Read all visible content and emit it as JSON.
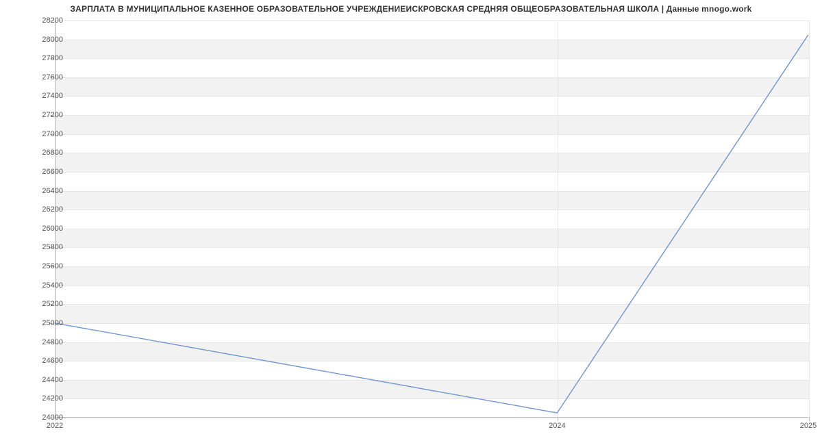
{
  "title": "ЗАРПЛАТА В МУНИЦИПАЛЬНОЕ КАЗЕННОЕ ОБРАЗОВАТЕЛЬНОЕ УЧРЕЖДЕНИЕИСКРОВСКАЯ СРЕДНЯЯ ОБЩЕОБРАЗОВАТЕЛЬНАЯ ШКОЛА | Данные mnogo.work",
  "chart_data": {
    "type": "line",
    "title": "ЗАРПЛАТА В МУНИЦИПАЛЬНОЕ КАЗЕННОЕ ОБРАЗОВАТЕЛЬНОЕ УЧРЕЖДЕНИЕИСКРОВСКАЯ СРЕДНЯЯ ОБЩЕОБРАЗОВАТЕЛЬНАЯ ШКОЛА | Данные mnogo.work",
    "x": [
      2022,
      2024,
      2025
    ],
    "values": [
      25000,
      24050,
      28050
    ],
    "x_ticks": [
      2022,
      2024,
      2025
    ],
    "y_ticks": [
      24000,
      24200,
      24400,
      24600,
      24800,
      25000,
      25200,
      25400,
      25600,
      25800,
      26000,
      26200,
      26400,
      26600,
      26800,
      27000,
      27200,
      27400,
      27600,
      27800,
      28000,
      28200
    ],
    "xlim": [
      2022,
      2025
    ],
    "ylim": [
      24000,
      28200
    ],
    "xlabel": "",
    "ylabel": "",
    "grid": true,
    "line_color": "#6f95d0"
  }
}
